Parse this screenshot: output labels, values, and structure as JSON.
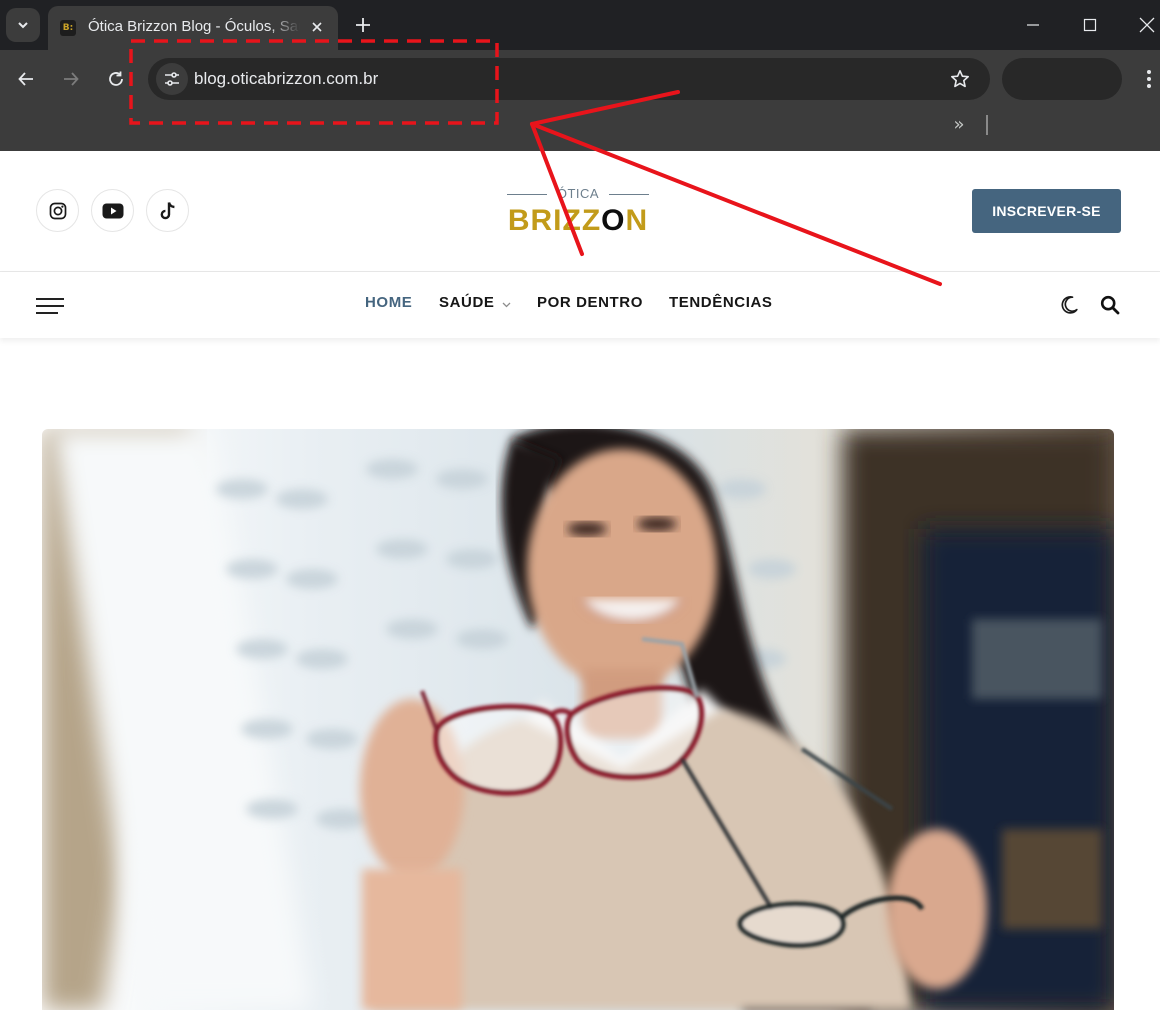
{
  "browser": {
    "tab_title": "Ótica Brizzon Blog - Óculos, Saúde e Tendências",
    "favicon_text": "B:",
    "url": "blog.oticabrizzon.com.br",
    "icons": {
      "tab_search": "chevron-down-icon",
      "tab_close": "close-icon",
      "new_tab": "plus-icon",
      "minimize": "minimize-icon",
      "maximize": "maximize-icon",
      "close_window": "close-icon",
      "back": "arrow-left-icon",
      "forward": "arrow-right-icon",
      "reload": "reload-icon",
      "site_info": "tune-icon",
      "bookmark": "star-icon",
      "menu": "kebab-menu-icon",
      "bookmarks_overflow": "double-chevron-icon"
    },
    "bookmarks_overflow_glyph": "»",
    "colors": {
      "tabstrip": "#202124",
      "toolbar": "#3c3c3c",
      "omnibox": "#282828"
    }
  },
  "site": {
    "social": [
      {
        "name": "instagram",
        "icon": "instagram-icon"
      },
      {
        "name": "youtube",
        "icon": "youtube-icon"
      },
      {
        "name": "tiktok",
        "icon": "tiktok-icon"
      }
    ],
    "logo": {
      "small": "ÓTICA",
      "big_part1": "BRIZZ",
      "big_part2": "O",
      "big_part3": "N"
    },
    "subscribe_label": "INSCREVER-SE",
    "nav": {
      "items": [
        "HOME",
        "SAÚDE",
        "POR DENTRO",
        "TENDÊNCIAS"
      ],
      "active": "HOME",
      "saude_has_dropdown": true
    },
    "icons": {
      "menu": "hamburger-icon",
      "dark_mode": "moon-icon",
      "search": "search-icon"
    },
    "colors": {
      "accent": "#45657f",
      "logo_gold": "#c29b1a",
      "logo_dark": "#0e0e0e"
    }
  },
  "hero": {
    "image": "featured-photo"
  },
  "annotation": {
    "color": "#e8141b",
    "shapes": [
      "dashed-rectangle-around-url",
      "arrow-from-logo",
      "arrow-from-header-right"
    ]
  }
}
